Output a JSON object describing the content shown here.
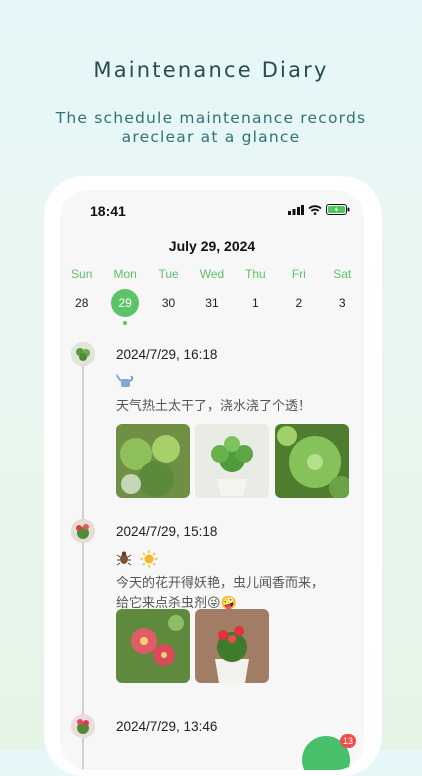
{
  "hero": {
    "title": "Maintenance Diary",
    "subtitle_line1": "The schedule maintenance records",
    "subtitle_line2": "areclear at a glance"
  },
  "status_bar": {
    "time": "18:41",
    "icons": [
      "signal-icon",
      "wifi-icon",
      "battery-icon"
    ]
  },
  "calendar": {
    "title": "July 29, 2024",
    "weekdays": [
      "Sun",
      "Mon",
      "Tue",
      "Wed",
      "Thu",
      "Fri",
      "Sat"
    ],
    "days": [
      "28",
      "29",
      "30",
      "31",
      "1",
      "2",
      "3"
    ],
    "selected_day": "29"
  },
  "entries": [
    {
      "time": "2024/7/29, 16:18",
      "icons": [
        "watering-can-icon"
      ],
      "text_line1": "天气热土太干了，浇水浇了个透！",
      "text_line2": "",
      "photos": [
        "plant-photo-1",
        "plant-photo-2",
        "plant-photo-3"
      ]
    },
    {
      "time": "2024/7/29, 15:18",
      "icons": [
        "bug-icon",
        "sun-icon"
      ],
      "text_line1": "今天的花开得妖艳，虫儿闻香而来，",
      "text_line2": "给它来点杀虫剂😜🤪",
      "photos": [
        "flower-photo-1",
        "flower-photo-2"
      ]
    },
    {
      "time": "2024/7/29, 13:46",
      "icons": [],
      "text_line1": "",
      "text_line2": "",
      "photos": []
    }
  ],
  "fab": {
    "badge": "13"
  },
  "colors": {
    "accent": "#5cc468",
    "badge": "#f24c4c"
  }
}
